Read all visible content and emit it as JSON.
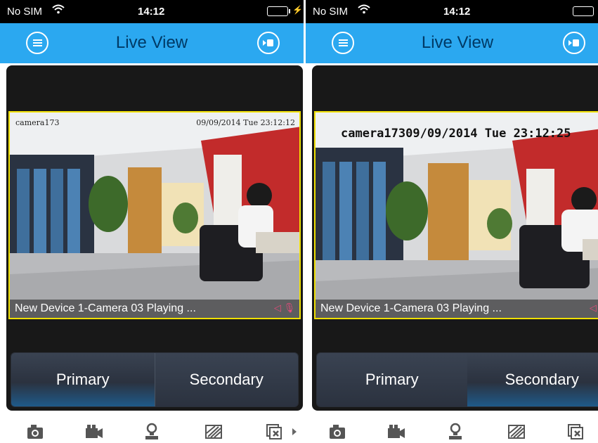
{
  "status": {
    "carrier": "No SIM",
    "time": "14:12"
  },
  "nav": {
    "title": "Live View"
  },
  "video": {
    "osd_camera": "camera173",
    "osd_datetime": "09/09/2014 Tue 23:12:12",
    "osd_combined": "camera17309/09/2014 Tue 23:12:25",
    "caption": "New Device 1-Camera 03  Playing ..."
  },
  "streams": {
    "primary": "Primary",
    "secondary": "Secondary",
    "selected": "primary"
  },
  "toolbar": [
    "camera-capture-icon",
    "video-record-icon",
    "ptz-icon",
    "image-quality-icon",
    "close-window-icon",
    "next-arrow-icon"
  ],
  "colors": {
    "nav_blue": "#2ba8f0",
    "title_color": "#003a66",
    "selection_border": "#f0e000",
    "battery_green": "#2ee62e"
  }
}
